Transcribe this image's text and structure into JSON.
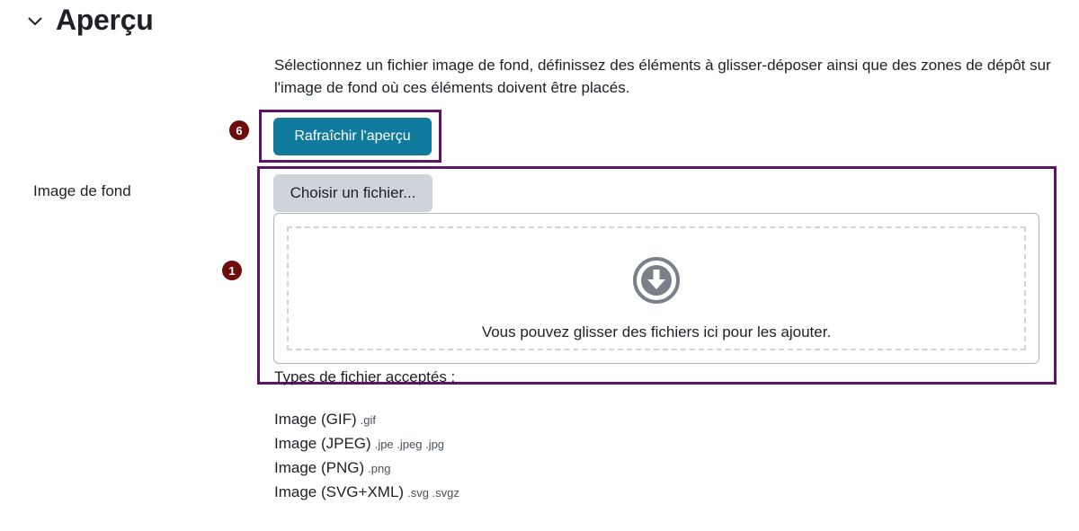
{
  "section": {
    "title": "Aperçu",
    "chevron_icon": "chevron-down-icon"
  },
  "intro": "Sélectionnez un fichier image de fond, définissez des éléments à glisser-déposer ainsi que des zones de dépôt sur l'image de fond où ces éléments doivent être placés.",
  "refresh_button": {
    "label": "Rafraîchir l'aperçu",
    "color": "#117b9e",
    "marker": "6"
  },
  "background_image": {
    "label": "Image de fond",
    "choose_button": "Choisir un fichier...",
    "marker": "1",
    "dropzone_icon": "download-circle-icon",
    "dropzone_text": "Vous pouvez glisser des fichiers ici pour les ajouter."
  },
  "accepted_types": {
    "heading": "Types de fichier acceptés :",
    "items": [
      {
        "name": "Image (GIF)",
        "ext": ".gif"
      },
      {
        "name": "Image (JPEG)",
        "ext": ".jpe .jpeg .jpg"
      },
      {
        "name": "Image (PNG)",
        "ext": ".png"
      },
      {
        "name": "Image (SVG+XML)",
        "ext": ".svg .svgz"
      }
    ]
  },
  "colors": {
    "highlight": "#5c1563",
    "marker": "#6e0c0c"
  }
}
